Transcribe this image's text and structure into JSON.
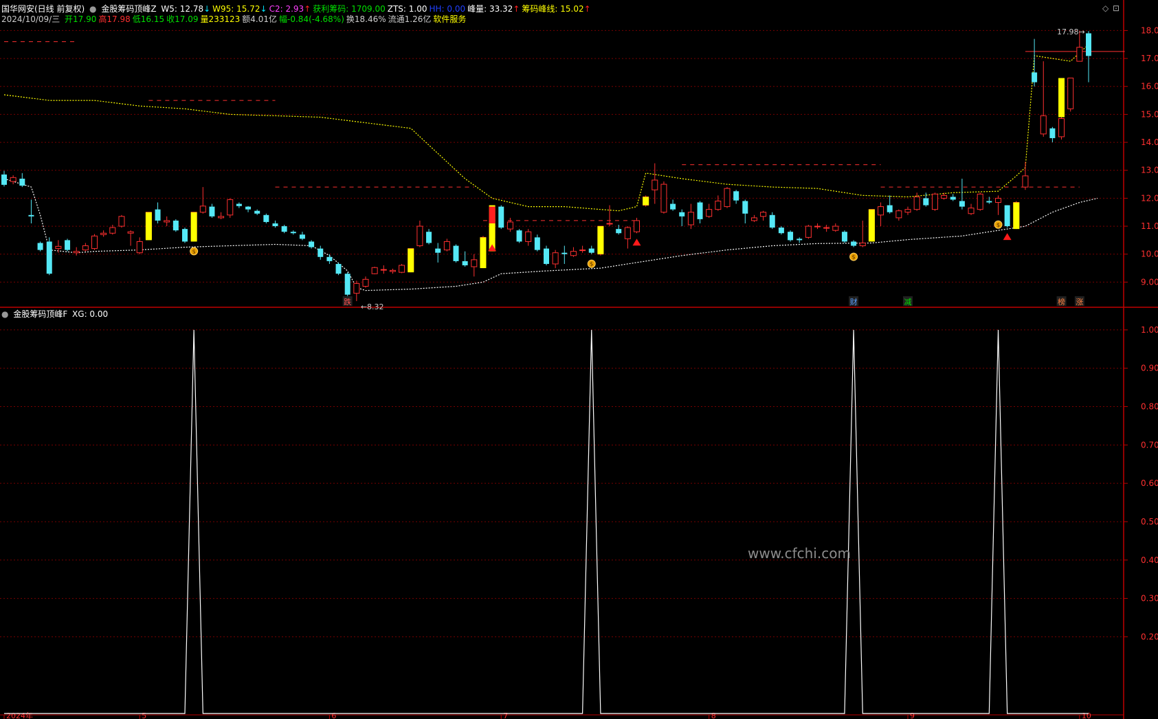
{
  "header": {
    "security": "国华网安(日线 前复权)",
    "indicator_main": "金股筹码顶峰Z",
    "items": [
      {
        "label": "W5: 12.78",
        "arrow": "↓",
        "color": "#ffffff",
        "arrow_color": "#00e5ff"
      },
      {
        "label": "W95: 15.72",
        "arrow": "↓",
        "color": "#ffff00",
        "arrow_color": "#00e5ff"
      },
      {
        "label": "C2: 2.93",
        "arrow": "↑",
        "color": "#ff40ff",
        "arrow_color": "#ff2020"
      },
      {
        "label": "获利筹码: 1709.00",
        "arrow": "",
        "color": "#00e000",
        "arrow_color": ""
      },
      {
        "label": "ZTS: 1.00",
        "arrow": "",
        "color": "#ffffff",
        "arrow_color": ""
      },
      {
        "label": "HH: 0.00",
        "arrow": "",
        "color": "#2040ff",
        "arrow_color": ""
      },
      {
        "label": "峰量: 33.32",
        "arrow": "↑",
        "color": "#ffffff",
        "arrow_color": "#ff2020"
      },
      {
        "label": "筹码峰线: 15.02",
        "arrow": "↑",
        "color": "#ffff00",
        "arrow_color": "#ff2020"
      }
    ],
    "ohlc_date": "2024/10/09/三",
    "ohlc": [
      {
        "text": "开17.90",
        "color": "#00e000"
      },
      {
        "text": "高17.98",
        "color": "#ff3030"
      },
      {
        "text": "低16.15",
        "color": "#00e000"
      },
      {
        "text": "收17.09",
        "color": "#00e000"
      },
      {
        "text": "量233123",
        "color": "#ffff00"
      },
      {
        "text": "额4.01亿",
        "color": "#cccccc"
      },
      {
        "text": "幅-0.84(-4.68%)",
        "color": "#00e000"
      },
      {
        "text": "换18.46%",
        "color": "#cccccc"
      },
      {
        "text": "流通1.26亿",
        "color": "#cccccc"
      },
      {
        "text": "软件服务",
        "color": "#ffff00"
      }
    ],
    "indicator_sub": "金股筹码顶峰F",
    "indicator_sub_value": "XG: 0.00"
  },
  "watermark": "www.cfchi.com",
  "colors": {
    "background": "#000000",
    "frame": "#c00000",
    "grid": "#7a0000",
    "up": "#ff3030",
    "down": "#55e8f6",
    "highlight": "#ffff00",
    "axis_text": "#ff3030",
    "ma_line": "#ffffff",
    "peak_line": "#ffff00"
  },
  "chart_data": [
    {
      "type": "candlestick",
      "ylim": [
        8.1,
        18.6
      ],
      "y_ticks": [
        "9.00",
        "10.00",
        "11.00",
        "12.00",
        "13.00",
        "14.00",
        "15.00",
        "16.00",
        "17.00",
        "18.00"
      ],
      "x_tick_labels": [
        "2024年",
        "5",
        "6",
        "7",
        "8",
        "9",
        "10"
      ],
      "x_tick_index": [
        0,
        15,
        36,
        55,
        78,
        100,
        119
      ],
      "candles": [
        [
          12.85,
          12.48,
          12.98,
          12.42
        ],
        [
          12.6,
          12.74,
          12.82,
          12.5
        ],
        [
          12.7,
          12.45,
          12.9,
          12.4
        ],
        [
          11.4,
          11.35,
          11.95,
          11.1
        ],
        [
          10.4,
          10.15,
          10.45,
          10.1
        ],
        [
          10.45,
          9.3,
          10.6,
          9.25
        ],
        [
          10.2,
          10.28,
          10.5,
          10.05
        ],
        [
          10.5,
          10.15,
          10.55,
          10.1
        ],
        [
          10.05,
          10.1,
          10.25,
          9.95
        ],
        [
          10.15,
          10.3,
          10.4,
          10.1
        ],
        [
          10.2,
          10.65,
          10.72,
          10.15
        ],
        [
          10.7,
          10.75,
          10.85,
          10.62
        ],
        [
          10.75,
          10.95,
          11.05,
          10.7
        ],
        [
          11.0,
          11.35,
          11.4,
          10.95
        ],
        [
          10.75,
          10.8,
          10.85,
          10.3
        ],
        [
          10.05,
          10.45,
          10.6,
          10.0
        ],
        [
          10.55,
          11.5,
          11.5,
          10.52
        ],
        [
          11.6,
          11.2,
          11.85,
          11.1
        ],
        [
          11.15,
          11.2,
          11.35,
          11.0
        ],
        [
          11.2,
          10.85,
          11.25,
          10.8
        ],
        [
          10.9,
          10.45,
          10.95,
          10.4
        ],
        [
          10.5,
          11.5,
          11.5,
          10.45
        ],
        [
          11.5,
          11.72,
          12.4,
          11.45
        ],
        [
          11.7,
          11.35,
          11.8,
          11.3
        ],
        [
          11.3,
          11.35,
          11.5,
          11.25
        ],
        [
          11.4,
          11.95,
          12.0,
          11.3
        ],
        [
          11.8,
          11.72,
          11.85,
          11.65
        ],
        [
          11.7,
          11.6,
          11.72,
          11.5
        ],
        [
          11.55,
          11.45,
          11.6,
          11.4
        ],
        [
          11.4,
          11.15,
          11.45,
          11.1
        ],
        [
          11.1,
          11.0,
          11.2,
          10.95
        ],
        [
          11.0,
          10.8,
          11.05,
          10.75
        ],
        [
          10.8,
          10.75,
          10.85,
          10.7
        ],
        [
          10.7,
          10.55,
          10.8,
          10.5
        ],
        [
          10.45,
          10.25,
          10.5,
          10.2
        ],
        [
          10.2,
          9.9,
          10.3,
          9.8
        ],
        [
          9.9,
          9.75,
          10.0,
          9.65
        ],
        [
          9.65,
          9.3,
          9.7,
          9.25
        ],
        [
          9.3,
          8.55,
          9.35,
          8.5
        ],
        [
          8.6,
          8.95,
          9.05,
          8.32
        ],
        [
          8.85,
          9.1,
          9.2,
          8.8
        ],
        [
          9.3,
          9.52,
          9.55,
          9.28
        ],
        [
          9.45,
          9.45,
          9.6,
          9.3
        ],
        [
          9.38,
          9.42,
          9.48,
          9.3
        ],
        [
          9.35,
          9.6,
          9.65,
          9.32
        ],
        [
          9.4,
          10.2,
          10.2,
          9.35
        ],
        [
          10.3,
          11.0,
          11.2,
          10.25
        ],
        [
          10.8,
          10.4,
          10.9,
          10.35
        ],
        [
          10.2,
          10.05,
          10.4,
          9.7
        ],
        [
          10.15,
          10.45,
          10.55,
          10.1
        ],
        [
          10.3,
          9.75,
          10.35,
          9.7
        ],
        [
          9.75,
          9.6,
          10.1,
          9.55
        ],
        [
          9.55,
          9.8,
          10.0,
          9.2
        ],
        [
          9.6,
          10.6,
          10.65,
          9.5
        ],
        [
          10.6,
          11.62,
          11.62,
          10.55
        ],
        [
          11.7,
          10.95,
          11.75,
          10.9
        ],
        [
          10.9,
          11.15,
          11.3,
          10.8
        ],
        [
          10.85,
          10.45,
          10.9,
          10.4
        ],
        [
          10.45,
          10.8,
          10.9,
          10.3
        ],
        [
          10.6,
          10.15,
          10.7,
          10.1
        ],
        [
          10.2,
          9.65,
          10.3,
          9.6
        ],
        [
          9.65,
          10.05,
          10.15,
          9.5
        ],
        [
          10.05,
          10.0,
          10.3,
          9.65
        ],
        [
          9.95,
          10.1,
          10.25,
          9.9
        ],
        [
          10.15,
          10.15,
          10.3,
          10.05
        ],
        [
          10.2,
          10.05,
          10.3,
          10.0
        ],
        [
          10.0,
          11.0,
          11.0,
          9.95
        ],
        [
          11.1,
          11.1,
          11.75,
          11.0
        ],
        [
          10.9,
          10.75,
          11.05,
          10.7
        ],
        [
          10.55,
          10.95,
          11.0,
          10.2
        ],
        [
          10.8,
          11.2,
          11.3,
          10.75
        ],
        [
          11.75,
          12.05,
          12.1,
          11.7
        ],
        [
          12.3,
          12.65,
          13.25,
          11.8
        ],
        [
          11.5,
          12.5,
          12.6,
          11.45
        ],
        [
          11.8,
          11.6,
          11.95,
          11.55
        ],
        [
          11.5,
          11.35,
          11.6,
          11.0
        ],
        [
          11.05,
          11.5,
          11.8,
          10.9
        ],
        [
          11.85,
          11.25,
          11.9,
          11.1
        ],
        [
          11.35,
          11.6,
          11.8,
          11.3
        ],
        [
          11.6,
          11.9,
          12.1,
          11.55
        ],
        [
          11.7,
          12.35,
          12.4,
          11.65
        ],
        [
          12.25,
          11.92,
          12.3,
          11.8
        ],
        [
          11.9,
          11.45,
          11.95,
          11.1
        ],
        [
          11.2,
          11.3,
          11.4,
          11.15
        ],
        [
          11.35,
          11.5,
          11.55,
          11.2
        ],
        [
          11.4,
          10.95,
          11.5,
          10.9
        ],
        [
          10.95,
          10.75,
          11.0,
          10.7
        ],
        [
          10.8,
          10.5,
          10.85,
          10.45
        ],
        [
          10.55,
          10.5,
          10.6,
          10.4
        ],
        [
          10.6,
          11.0,
          11.05,
          10.55
        ],
        [
          11.0,
          11.0,
          11.1,
          10.9
        ],
        [
          10.95,
          10.95,
          11.05,
          10.8
        ],
        [
          10.85,
          11.0,
          11.1,
          10.8
        ],
        [
          10.8,
          10.45,
          10.85,
          10.4
        ],
        [
          10.45,
          10.3,
          10.5,
          10.25
        ],
        [
          10.3,
          10.4,
          11.2,
          10.25
        ],
        [
          10.5,
          11.6,
          11.6,
          10.45
        ],
        [
          11.4,
          11.7,
          11.85,
          11.0
        ],
        [
          11.75,
          11.5,
          12.1,
          11.45
        ],
        [
          11.3,
          11.55,
          11.6,
          11.2
        ],
        [
          11.5,
          11.6,
          11.7,
          11.4
        ],
        [
          11.6,
          12.05,
          12.2,
          11.55
        ],
        [
          12.0,
          11.75,
          12.2,
          11.7
        ],
        [
          11.6,
          12.15,
          12.2,
          11.55
        ],
        [
          12.0,
          12.1,
          12.2,
          11.95
        ],
        [
          12.05,
          11.95,
          12.15,
          11.9
        ],
        [
          11.9,
          11.7,
          12.7,
          11.6
        ],
        [
          11.45,
          11.65,
          11.8,
          11.4
        ],
        [
          11.6,
          12.15,
          12.2,
          11.55
        ],
        [
          11.9,
          11.85,
          12.05,
          11.8
        ],
        [
          11.85,
          12.0,
          12.1,
          11.4
        ],
        [
          11.75,
          11.0,
          11.75,
          10.95
        ],
        [
          10.95,
          11.85,
          11.9,
          10.9
        ],
        [
          12.4,
          12.8,
          13.3,
          12.3
        ],
        [
          16.5,
          16.15,
          17.7,
          16.0
        ],
        [
          14.3,
          14.95,
          16.9,
          14.2
        ],
        [
          14.5,
          14.15,
          14.55,
          14.0
        ],
        [
          14.2,
          14.85,
          15.2,
          14.1
        ],
        [
          15.2,
          16.3,
          16.3,
          15.1
        ],
        [
          16.9,
          17.4,
          17.98,
          16.9
        ],
        [
          17.9,
          17.09,
          17.98,
          16.15
        ]
      ],
      "yellow_bars": [
        [
          10.5,
          11.5
        ],
        [
          10.45,
          11.5
        ],
        [
          9.35,
          10.2
        ],
        [
          9.5,
          10.6
        ],
        [
          11.05,
          11.75
        ],
        [
          10.1,
          11.05
        ],
        [
          10.0,
          11.0
        ],
        [
          11.75,
          12.05
        ],
        [
          10.45,
          11.6
        ],
        [
          10.9,
          11.85
        ],
        [
          14.9,
          16.3
        ]
      ],
      "yellow_bar_index": [
        16,
        21,
        45,
        53,
        54,
        54,
        66,
        71,
        96,
        112,
        117
      ],
      "red_box": {
        "index": 54,
        "range": [
          11.1,
          11.7
        ]
      },
      "ma_line": [
        [
          0,
          12.7
        ],
        [
          3,
          12.4
        ],
        [
          4,
          11.4
        ],
        [
          5,
          10.15
        ],
        [
          8,
          10.05
        ],
        [
          10,
          10.1
        ],
        [
          15,
          10.15
        ],
        [
          20,
          10.25
        ],
        [
          25,
          10.3
        ],
        [
          30,
          10.35
        ],
        [
          34,
          10.3
        ],
        [
          36,
          9.95
        ],
        [
          38,
          9.4
        ],
        [
          39,
          8.8
        ],
        [
          40,
          8.7
        ],
        [
          45,
          8.75
        ],
        [
          50,
          8.85
        ],
        [
          53,
          9.0
        ],
        [
          55,
          9.3
        ],
        [
          60,
          9.4
        ],
        [
          66,
          9.5
        ],
        [
          70,
          9.7
        ],
        [
          75,
          9.95
        ],
        [
          80,
          10.15
        ],
        [
          85,
          10.3
        ],
        [
          90,
          10.38
        ],
        [
          96,
          10.4
        ],
        [
          100,
          10.52
        ],
        [
          106,
          10.65
        ],
        [
          112,
          10.95
        ],
        [
          113,
          11.0
        ],
        [
          116,
          11.5
        ],
        [
          119,
          11.85
        ],
        [
          121,
          12.0
        ]
      ],
      "peak_line": [
        [
          0,
          15.7
        ],
        [
          5,
          15.5
        ],
        [
          10,
          15.5
        ],
        [
          15,
          15.3
        ],
        [
          20,
          15.2
        ],
        [
          25,
          15.0
        ],
        [
          30,
          14.95
        ],
        [
          35,
          14.9
        ],
        [
          40,
          14.7
        ],
        [
          45,
          14.5
        ],
        [
          48,
          13.6
        ],
        [
          51,
          12.7
        ],
        [
          54,
          12.0
        ],
        [
          58,
          11.7
        ],
        [
          62,
          11.7
        ],
        [
          66,
          11.6
        ],
        [
          68,
          11.55
        ],
        [
          70,
          11.7
        ],
        [
          71,
          12.9
        ],
        [
          75,
          12.7
        ],
        [
          80,
          12.5
        ],
        [
          85,
          12.4
        ],
        [
          90,
          12.35
        ],
        [
          95,
          12.1
        ],
        [
          100,
          12.05
        ],
        [
          105,
          12.2
        ],
        [
          110,
          12.25
        ],
        [
          112,
          12.8
        ],
        [
          113,
          13.1
        ],
        [
          114,
          17.1
        ],
        [
          118,
          16.9
        ],
        [
          120,
          17.5
        ]
      ],
      "dashed_levels": [
        {
          "y": 17.6,
          "from": 0,
          "to": 8
        },
        {
          "y": 15.5,
          "from": 16,
          "to": 30
        },
        {
          "y": 12.4,
          "from": 30,
          "to": 52
        },
        {
          "y": 11.2,
          "from": 53,
          "to": 70
        },
        {
          "y": 13.2,
          "from": 75,
          "to": 97
        },
        {
          "y": 12.4,
          "from": 97,
          "to": 119
        }
      ],
      "hline": {
        "y": 17.25,
        "from": 113,
        "to": 124
      },
      "buy_markers": [
        54,
        70,
        111
      ],
      "moneybag_markers": [
        21,
        65,
        94,
        110
      ],
      "event_labels": [
        {
          "index": 38,
          "text": "跌",
          "color": "#ff5050"
        },
        {
          "index": 94,
          "text": "财",
          "color": "#5aa0ff"
        },
        {
          "index": 100,
          "text": "减",
          "color": "#00e000"
        },
        {
          "index": 117,
          "text": "榜",
          "color": "#ff8040"
        },
        {
          "index": 119,
          "text": "涨",
          "color": "#ff8040"
        }
      ],
      "annotations": [
        {
          "index": 39,
          "value": 8.32,
          "text": "8.32"
        },
        {
          "index": 120,
          "value": 17.98,
          "text": "17.98"
        }
      ]
    },
    {
      "type": "line",
      "series_label": "XG",
      "ylim": [
        0.0,
        1.05
      ],
      "y_ticks": [
        "0.20",
        "0.30",
        "0.40",
        "0.50",
        "0.60",
        "0.70",
        "0.80",
        "0.90",
        "1.00"
      ],
      "spike_index": [
        21,
        65,
        94,
        110
      ],
      "n": 121
    }
  ]
}
